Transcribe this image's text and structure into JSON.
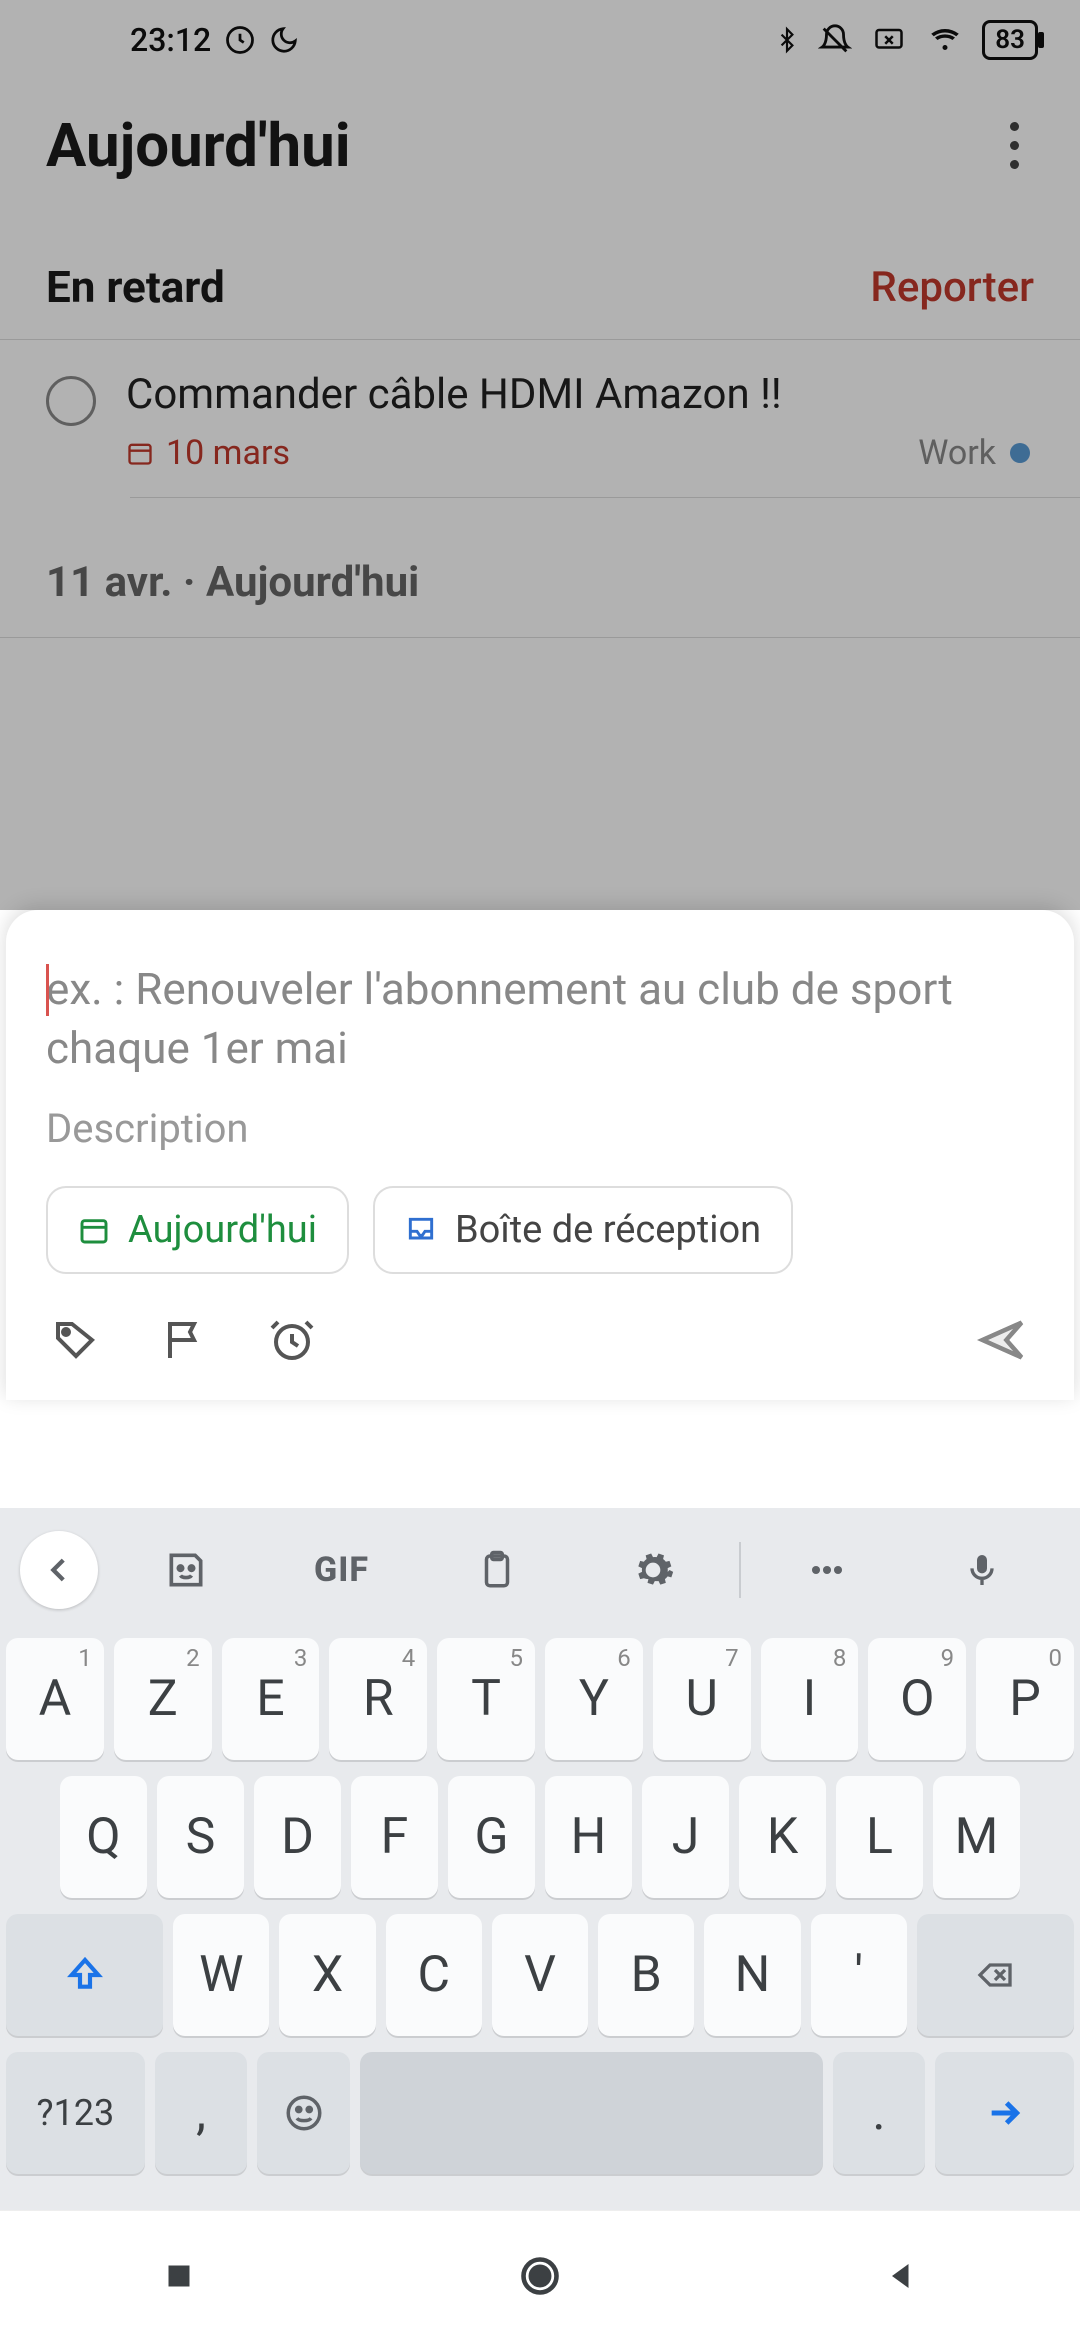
{
  "status": {
    "time": "23:12",
    "battery": "83"
  },
  "header": {
    "title": "Aujourd'hui"
  },
  "overdue": {
    "title": "En retard",
    "action": "Reporter",
    "task": {
      "title": "Commander câble HDMI Amazon !!",
      "date": "10 mars",
      "project": "Work"
    }
  },
  "today_header": "11 avr. · Aujourd'hui",
  "sheet": {
    "task_placeholder": "ex. : Renouveler l'abonnement au club de sport chaque 1er mai",
    "desc_placeholder": "Description",
    "chip_today": "Aujourd'hui",
    "chip_inbox": "Boîte de réception"
  },
  "keyboard": {
    "gif": "GIF",
    "row1": [
      {
        "k": "A",
        "s": "1"
      },
      {
        "k": "Z",
        "s": "2"
      },
      {
        "k": "E",
        "s": "3"
      },
      {
        "k": "R",
        "s": "4"
      },
      {
        "k": "T",
        "s": "5"
      },
      {
        "k": "Y",
        "s": "6"
      },
      {
        "k": "U",
        "s": "7"
      },
      {
        "k": "I",
        "s": "8"
      },
      {
        "k": "O",
        "s": "9"
      },
      {
        "k": "P",
        "s": "0"
      }
    ],
    "row2": [
      "Q",
      "S",
      "D",
      "F",
      "G",
      "H",
      "J",
      "K",
      "L",
      "M"
    ],
    "row3": [
      "W",
      "X",
      "C",
      "V",
      "B",
      "N",
      "'"
    ],
    "numkey": "?123",
    "comma": ",",
    "period": "."
  }
}
